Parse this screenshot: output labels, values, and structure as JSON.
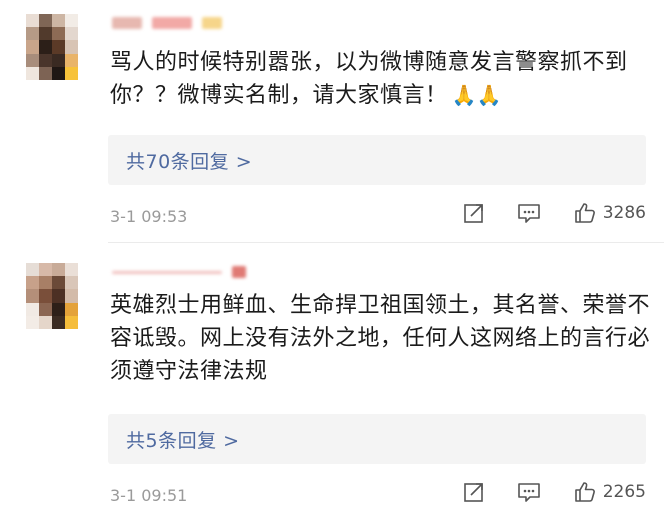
{
  "comments": [
    {
      "text": "骂人的时候特别嚣张，以为微博随意发言警察抓不到你？？微博实名制，请大家慎言！",
      "emoji": "🙏🙏",
      "replies_label": "共70条回复 >",
      "timestamp": "3-1 09:53",
      "likes": "3286"
    },
    {
      "text": "英雄烈士用鲜血、生命捍卫祖国领土，其名誉、荣誉不容诋毁。网上没有法外之地，任何人这网络上的言行必须遵守法律法规",
      "replies_label": "共5条回复 >",
      "timestamp": "3-1 09:51",
      "likes": "2265"
    }
  ],
  "icons": [
    "share-icon",
    "comment-icon",
    "like-icon"
  ],
  "colors": {
    "link": "#4f6aa0",
    "meta": "#9a9a9a",
    "reply_bg": "#f4f4f4"
  }
}
